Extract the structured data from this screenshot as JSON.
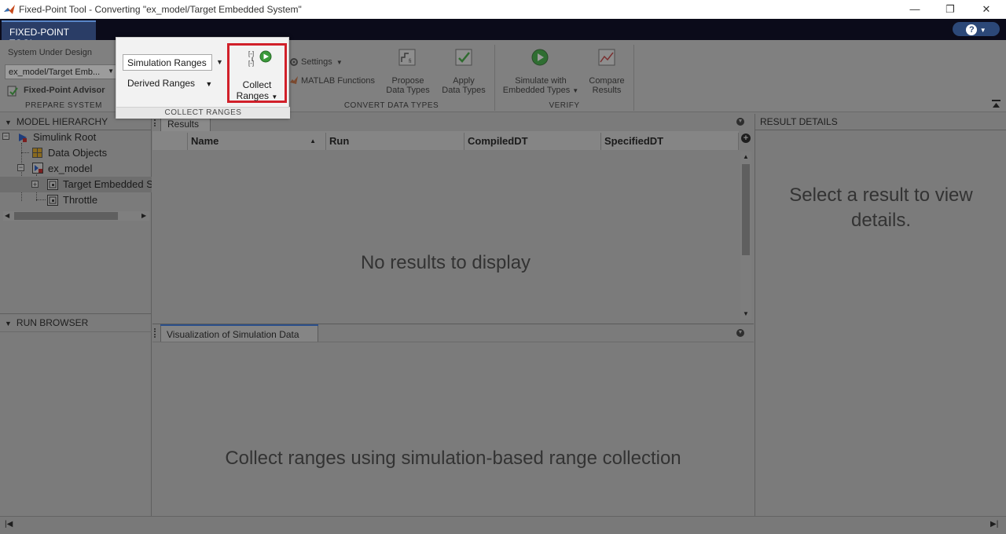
{
  "window": {
    "title": "Fixed-Point Tool - Converting \"ex_model/Target Embedded System\"",
    "minimize": "—",
    "restore": "❐",
    "close": "✕"
  },
  "tabs": {
    "fixed_point_tool": "FIXED-POINT TOOL",
    "help": "?"
  },
  "toolstrip": {
    "prepare": {
      "sud_label": "System Under Design",
      "sud_value": "ex_model/Target Emb...",
      "advisor_label": "Fixed-Point Advisor",
      "section": "PREPARE SYSTEM"
    },
    "convert": {
      "settings": "Settings",
      "matlab_functions": "MATLAB Functions",
      "propose_line1": "Propose",
      "propose_line2": "Data Types",
      "apply_line1": "Apply",
      "apply_line2": "Data Types",
      "section": "CONVERT DATA TYPES"
    },
    "verify": {
      "simulate_line1": "Simulate with",
      "simulate_line2": "Embedded Types",
      "compare_line1": "Compare",
      "compare_line2": "Results",
      "section": "VERIFY"
    }
  },
  "collect_ranges": {
    "sim_ranges": "Simulation Ranges",
    "derived_ranges": "Derived Ranges",
    "collect_line1": "Collect",
    "collect_line2": "Ranges",
    "section": "COLLECT RANGES"
  },
  "model_hierarchy": {
    "header": "MODEL HIERARCHY",
    "items": [
      "Simulink Root",
      "Data Objects",
      "ex_model",
      "Target Embedded S",
      "Throttle"
    ]
  },
  "run_browser": {
    "header": "RUN BROWSER"
  },
  "results": {
    "tab": "Results",
    "columns": [
      "Name",
      "Run",
      "CompiledDT",
      "SpecifiedDT"
    ],
    "empty": "No results to display"
  },
  "visualization": {
    "tab": "Visualization of Simulation Data",
    "message": "Collect ranges using simulation-based range collection"
  },
  "result_details": {
    "header": "RESULT DETAILS",
    "message_line1": "Select a result to view",
    "message_line2": "details."
  }
}
